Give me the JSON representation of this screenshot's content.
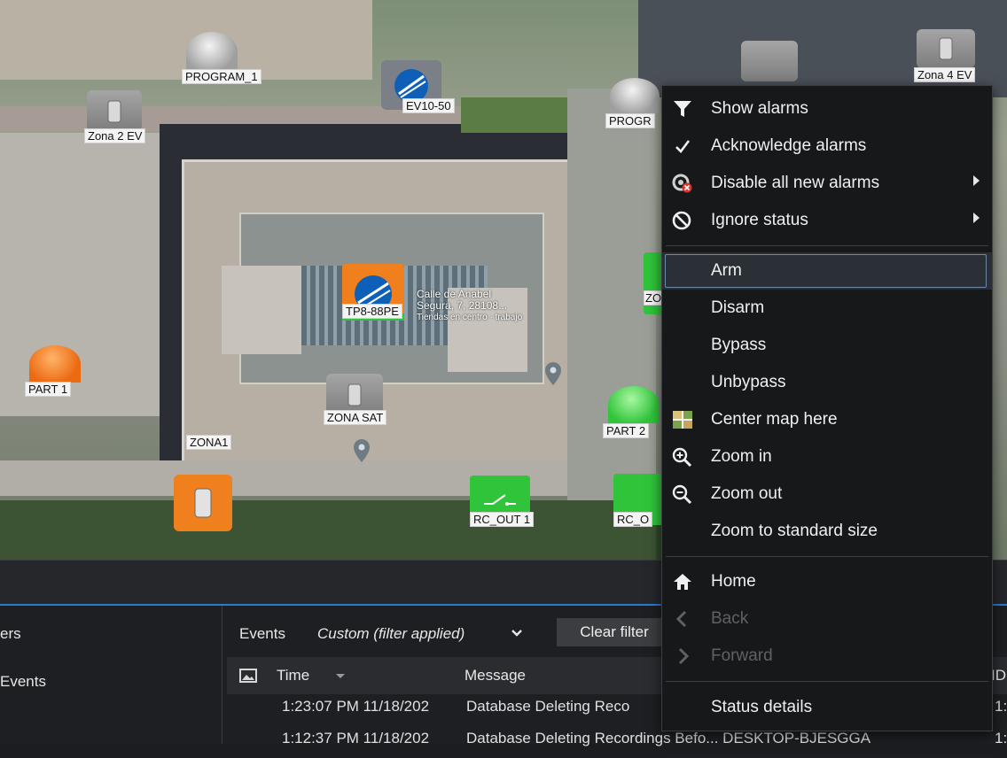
{
  "map": {
    "markers": [
      {
        "id": "program1",
        "label": "PROGRAM_1",
        "kind": "sphere-gray"
      },
      {
        "id": "ev1050",
        "label": "EV10-50",
        "kind": "tile-blue"
      },
      {
        "id": "zona2ev",
        "label": "Zona 2 EV",
        "kind": "tile-gray"
      },
      {
        "id": "progr",
        "label": "PROGR",
        "kind": "sphere-gray"
      },
      {
        "id": "zona4ev",
        "label": "Zona 4 EV",
        "kind": "tile-gray"
      },
      {
        "id": "tp888pe",
        "label": "TP8-88PE",
        "kind": "tile-orange"
      },
      {
        "id": "part1",
        "label": "PART 1",
        "kind": "sphere-orange"
      },
      {
        "id": "zonasat",
        "label": "ZONA SAT",
        "kind": "tile-gray"
      },
      {
        "id": "zona1",
        "label": "ZONA1",
        "kind": "label"
      },
      {
        "id": "part2",
        "label": "PART 2",
        "kind": "sphere-green"
      },
      {
        "id": "rcout1",
        "label": "RC_OUT 1",
        "kind": "tile-green"
      },
      {
        "id": "rco",
        "label": "RC_O",
        "kind": "tile-green"
      },
      {
        "id": "zo",
        "label": "ZO",
        "kind": "tile-green"
      }
    ],
    "street": {
      "line1": "Calle de Anabel",
      "line2": "Segura, 7, 28108...",
      "line3": "Tiendas en centro · trabajo"
    }
  },
  "left_nav": {
    "item1": "ers",
    "item2": "Events"
  },
  "events": {
    "label": "Events",
    "filter": "Custom (filter applied)",
    "clear_filter": "Clear filter",
    "columns": {
      "time": "Time",
      "message": "Message",
      "id": "ID"
    },
    "rows": [
      {
        "time": "1:23:07 PM 11/18/202",
        "message": "Database Deleting Reco",
        "id": "1:"
      },
      {
        "time": "1:12:37 PM 11/18/202",
        "message": "Database Deleting Recordings Befo... DESKTOP-BJESGGA",
        "id": "1:"
      }
    ]
  },
  "context_menu": {
    "items": [
      {
        "label": "Show alarms",
        "icon": "filter-icon"
      },
      {
        "label": "Acknowledge alarms",
        "icon": "check-icon"
      },
      {
        "label": "Disable all new alarms",
        "icon": "alarm-disable-icon",
        "submenu": true
      },
      {
        "label": "Ignore status",
        "icon": "ban-icon",
        "submenu": true
      },
      {
        "label": "Arm",
        "highlighted": true
      },
      {
        "label": "Disarm"
      },
      {
        "label": "Bypass"
      },
      {
        "label": "Unbypass"
      },
      {
        "label": "Center map here",
        "icon": "map-center-icon"
      },
      {
        "label": "Zoom in",
        "icon": "zoom-in-icon"
      },
      {
        "label": "Zoom out",
        "icon": "zoom-out-icon"
      },
      {
        "label": "Zoom to standard size"
      },
      {
        "label": "Home",
        "icon": "home-icon"
      },
      {
        "label": "Back",
        "icon": "chevron-left-icon",
        "disabled": true
      },
      {
        "label": "Forward",
        "icon": "chevron-right-icon",
        "disabled": true
      },
      {
        "label": "Status details"
      }
    ]
  },
  "colors": {
    "accent": "#2b7bd0",
    "tile_orange": "#f07f1e",
    "tile_green": "#2fc43a",
    "tile_blue": "#0d5fb8",
    "tile_gray": "#8c8c8c"
  }
}
